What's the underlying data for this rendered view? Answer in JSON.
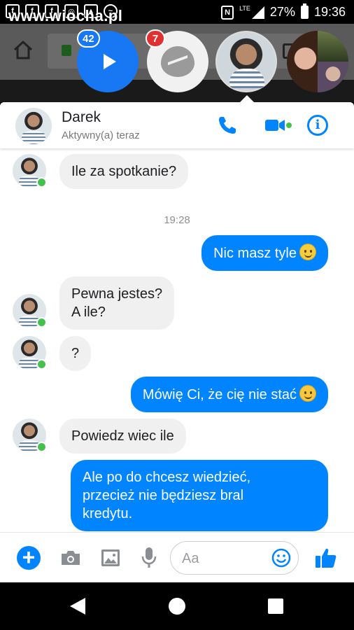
{
  "watermark": "www.wiocha.pl",
  "status_bar": {
    "network": "LTE",
    "battery": "27%",
    "time": "19:36"
  },
  "browser": {
    "url_partial": "be"
  },
  "chat_heads": {
    "video_badge": "42",
    "messenger_badge": "7"
  },
  "header": {
    "name": "Darek",
    "status": "Aktywny(a) teraz"
  },
  "messages": [
    {
      "from": "in",
      "text": "Ile za spotkanie?"
    },
    {
      "timestamp": "19:28"
    },
    {
      "from": "out",
      "text": "Nic masz tyle",
      "emoji": "slight-smile"
    },
    {
      "from": "in",
      "line1": "Pewna jestes?",
      "line2": "A ile?"
    },
    {
      "from": "in",
      "text": "?"
    },
    {
      "from": "out",
      "text": "Mówię Ci, że cię nie stać",
      "emoji": "blush-smile"
    },
    {
      "from": "in",
      "text": "Powiedz wiec ile"
    },
    {
      "from": "out",
      "line1": "Ale po do chcesz wiedzieć,",
      "line2": "przecież nie będziesz bral",
      "line3": "kredytu."
    }
  ],
  "composer": {
    "placeholder": "Aa"
  },
  "colors": {
    "accent": "#0084ff",
    "online": "#44c14c",
    "badge_red": "#e0302f"
  }
}
